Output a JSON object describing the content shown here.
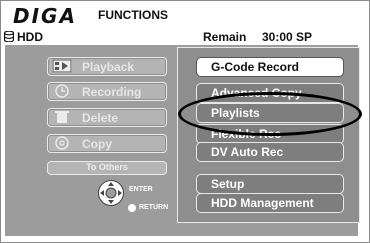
{
  "header": {
    "logo": "DIGA",
    "title": "FUNCTIONS",
    "drive": "HDD",
    "remain_label": "Remain",
    "remain_value": "30:00 SP"
  },
  "left_menu": {
    "items": [
      {
        "label": "Playback",
        "icon": "playback-icon"
      },
      {
        "label": "Recording",
        "icon": "clock-icon"
      },
      {
        "label": "Delete",
        "icon": "trash-icon"
      },
      {
        "label": "Copy",
        "icon": "disc-icon"
      }
    ],
    "to_others": "To Others",
    "enter": "ENTER",
    "return": "RETURN"
  },
  "right_menu": {
    "items": [
      {
        "label": "G-Code Record",
        "selected": true
      },
      {
        "label": "Advanced Copy",
        "selected": false
      },
      {
        "label": "Playlists",
        "selected": false
      },
      {
        "label": "Flexible Rec",
        "selected": false
      },
      {
        "label": "DV Auto Rec",
        "selected": false
      },
      {
        "label": "Setup",
        "selected": false
      },
      {
        "label": "HDD Management",
        "selected": false
      }
    ]
  },
  "colors": {
    "panel_bg": "#9c9c9c",
    "menu_bg": "#8e8e8e",
    "button_bg": "#7e7e7e",
    "selected_bg": "#ffffff"
  }
}
